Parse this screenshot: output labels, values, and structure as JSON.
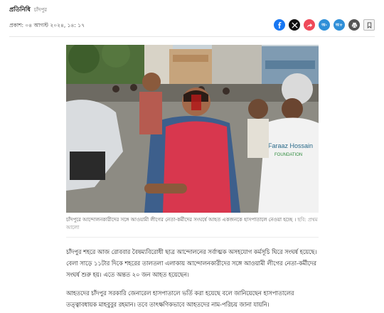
{
  "byline": {
    "author": "প্রতিনিধি",
    "location": "চাঁদপুর"
  },
  "published": "প্রকাশ: ০৪ আগস্ট ২০২৪, ১৪: ১৭",
  "share": {
    "buttons": [
      {
        "name": "facebook-share-icon",
        "glyph": "f",
        "color": "#1877f2"
      },
      {
        "name": "x-share-icon",
        "glyph": "X",
        "color": "#111111"
      },
      {
        "name": "forward-share-icon",
        "glyph": "➦",
        "color": "#ef4a5a"
      },
      {
        "name": "font-decrease-icon",
        "glyph": "অ-",
        "color": "#2f8fd8"
      },
      {
        "name": "font-increase-icon",
        "glyph": "অ+",
        "color": "#2f8fd8"
      },
      {
        "name": "print-icon",
        "glyph": "⎙",
        "color": "#555555"
      }
    ],
    "bookmark_icon": "bookmark-icon"
  },
  "photo": {
    "alt": "চাঁদপুরে আন্দোলনকারীদের সঙ্গে আওয়ামী লীগের নেতা-কর্মীদের সংঘর্ষে আহত একজনকে হাসপাতালে নেওয়া হচ্ছে",
    "tshirt_text_1": "Faraaz Hossain",
    "tshirt_text_2": "FOUNDATION"
  },
  "caption": {
    "text": "চাঁদপুরে আন্দোলনকারীদের সঙ্গে আওয়ামী লীগের নেতা-কর্মীদের সংঘর্ষে আহত একজনকে হাসপাতালে নেওয়া হচ্ছে ।",
    "credit": "ছবি: প্রথম আলো"
  },
  "article": {
    "paragraphs": [
      "চাঁদপুর শহরে আজ রোববার বৈষম্যবিরোধী ছাত্র আন্দোলনের সর্বাত্মক অসহযোগ কর্মসূচি ঘিরে সংঘর্ষ হয়েছে। বেলা সাড়ে ১১টার দিকে শহরের তালতলা এলাকায় আন্দোলনকারীদের সঙ্গে আওয়ামী লীগের নেতা-কর্মীদের সংঘর্ষ শুরু হয়। এতে অন্তত ২০ জন আহত হয়েছেন।",
      "আহতদের চাঁদপুর সরকারি জেনারেল হাসপাতালে ভর্তি করা হয়েছে বলে জানিয়েছেন হাসপাতালের তত্ত্বাবধায়ক মাহবুবুর রহমান। তবে তাৎক্ষণিকভাবে আহতদের নাম-পরিচয় জানা যায়নি।"
    ]
  }
}
